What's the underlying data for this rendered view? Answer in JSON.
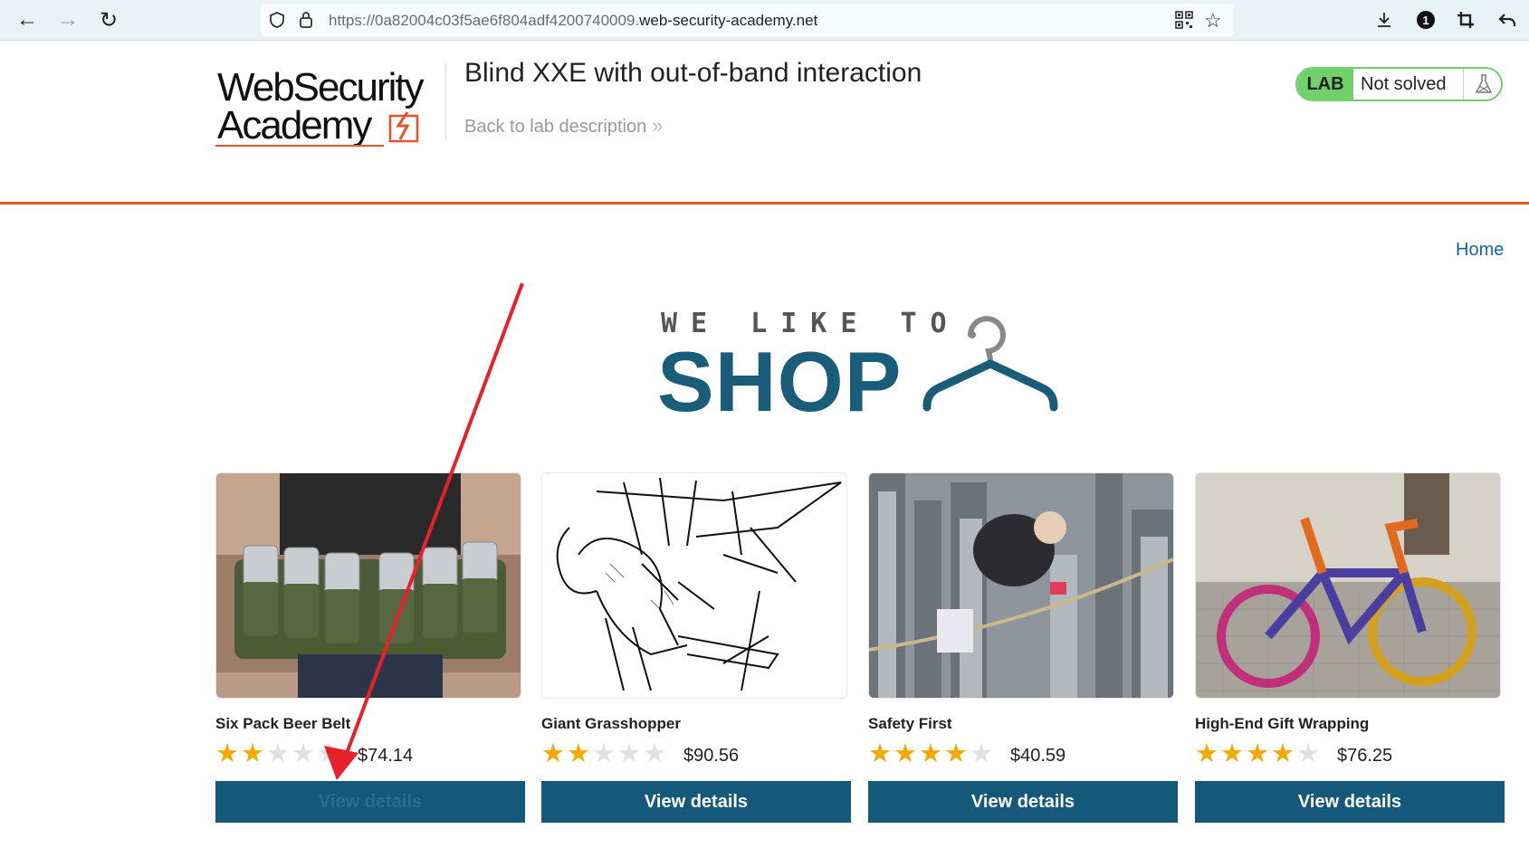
{
  "browser": {
    "url_prefix": "https://0a82004c03f5ae6f804adf4200740009.",
    "url_domain": "web-security-academy.net",
    "badge_count": "1"
  },
  "header": {
    "logo_line1": "WebSecurity",
    "logo_line2": "Academy",
    "lab_title": "Blind XXE with out-of-band interaction",
    "back_link": "Back to lab description",
    "back_chevron": "»",
    "lab_tag": "LAB",
    "lab_status": "Not solved",
    "accent_color": "#e0542e",
    "lab_green": "#70d16b"
  },
  "nav": {
    "home": "Home"
  },
  "hero": {
    "small": "WE LIKE TO",
    "big": "SHOP",
    "color": "#1a5d7a"
  },
  "products": [
    {
      "name": "Six Pack Beer Belt",
      "rating": 2,
      "price": "$74.14",
      "button": "View details",
      "image": "beer-belt-photo"
    },
    {
      "name": "Giant Grasshopper",
      "rating": 2,
      "price": "$90.56",
      "button": "View details",
      "image": "grasshopper-drawing"
    },
    {
      "name": "Safety First",
      "rating": 4,
      "price": "$40.59",
      "button": "View details",
      "image": "tightrope-city-photo"
    },
    {
      "name": "High-End Gift Wrapping",
      "rating": 4,
      "price": "$76.25",
      "button": "View details",
      "image": "knitted-bicycle-photo"
    }
  ],
  "button_color": "#15597a",
  "annotation": {
    "color": "#e8202a"
  }
}
